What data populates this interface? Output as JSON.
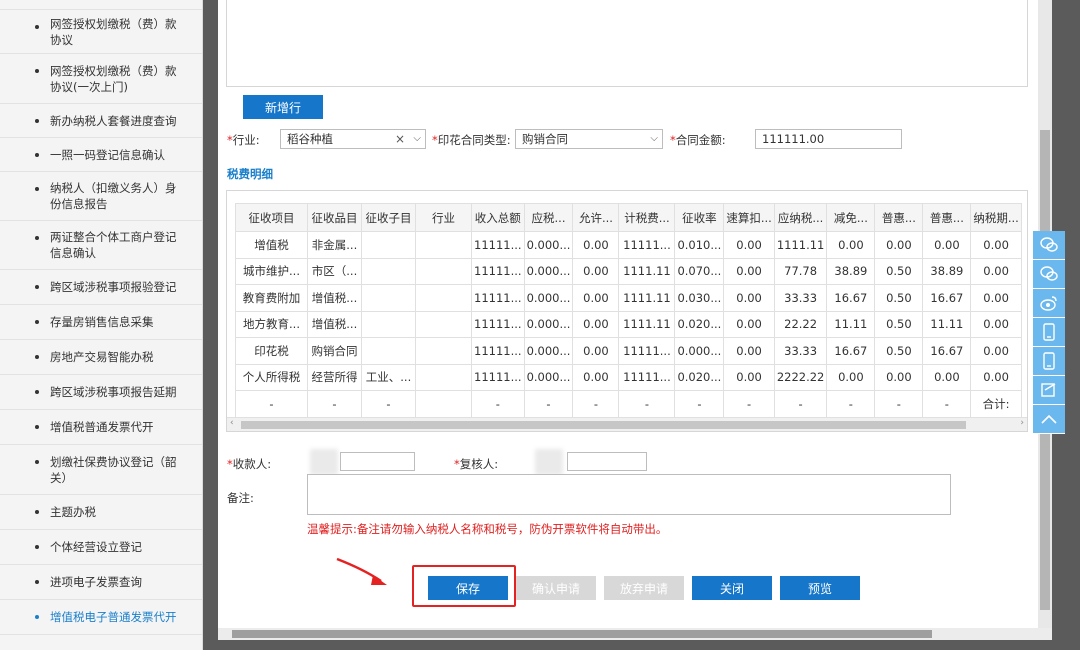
{
  "sidebar": {
    "items": [
      {
        "label": "网签授权划缴税（费）款协议"
      },
      {
        "label": "网签授权划缴税（费）款协议(一次上门)"
      },
      {
        "label": "新办纳税人套餐进度查询"
      },
      {
        "label": "一照一码登记信息确认"
      },
      {
        "label": "纳税人（扣缴义务人）身份信息报告"
      },
      {
        "label": "两证整合个体工商户登记信息确认"
      },
      {
        "label": "跨区域涉税事项报验登记"
      },
      {
        "label": "存量房销售信息采集"
      },
      {
        "label": "房地产交易智能办税"
      },
      {
        "label": "跨区域涉税事项报告延期"
      },
      {
        "label": "增值税普通发票代开"
      },
      {
        "label": "划缴社保费协议登记（韶关）"
      },
      {
        "label": "主题办税"
      },
      {
        "label": "个体经营设立登记"
      },
      {
        "label": "进项电子发票查询"
      },
      {
        "label": "增值税电子普通发票代开"
      }
    ]
  },
  "form": {
    "add_row_label": "新增行",
    "industry_label": "行业:",
    "industry_value": "稻谷种植",
    "contract_type_label": "印花合同类型:",
    "contract_type_value": "购销合同",
    "contract_amount_label": "合同金额:",
    "contract_amount_value": "111111.00",
    "section_title": "税费明细"
  },
  "table": {
    "headers": [
      "征收项目",
      "征收品目",
      "征收子目",
      "行业",
      "收入总额",
      "应税...",
      "允许...",
      "计税费...",
      "征收率",
      "速算扣...",
      "应纳税...",
      "减免...",
      "普惠...",
      "普惠...",
      "纳税期..."
    ],
    "rows": [
      [
        "增值税",
        "非金属...",
        "",
        "",
        "11111...",
        "0.000...",
        "0.00",
        "11111...",
        "0.010...",
        "0.00",
        "1111.11",
        "0.00",
        "0.00",
        "0.00",
        "0.00"
      ],
      [
        "城市维护...",
        "市区（...",
        "",
        "",
        "11111...",
        "0.000...",
        "0.00",
        "1111.11",
        "0.070...",
        "0.00",
        "77.78",
        "38.89",
        "0.50",
        "38.89",
        "0.00"
      ],
      [
        "教育费附加",
        "增值税...",
        "",
        "",
        "11111...",
        "0.000...",
        "0.00",
        "1111.11",
        "0.030...",
        "0.00",
        "33.33",
        "16.67",
        "0.50",
        "16.67",
        "0.00"
      ],
      [
        "地方教育...",
        "增值税...",
        "",
        "",
        "11111...",
        "0.000...",
        "0.00",
        "1111.11",
        "0.020...",
        "0.00",
        "22.22",
        "11.11",
        "0.50",
        "11.11",
        "0.00"
      ],
      [
        "印花税",
        "购销合同",
        "",
        "",
        "11111...",
        "0.000...",
        "0.00",
        "11111...",
        "0.000...",
        "0.00",
        "33.33",
        "16.67",
        "0.50",
        "16.67",
        "0.00"
      ],
      [
        "个人所得税",
        "经营所得",
        "工业、...",
        "",
        "11111...",
        "0.000...",
        "0.00",
        "11111...",
        "0.020...",
        "0.00",
        "2222.22",
        "0.00",
        "0.00",
        "0.00",
        "0.00"
      ],
      [
        "-",
        "-",
        "-",
        "",
        "-",
        "-",
        "-",
        "-",
        "-",
        "-",
        "-",
        "-",
        "-",
        "-",
        "合计:"
      ]
    ]
  },
  "bottom": {
    "payee_label": "收款人:",
    "reviewer_label": "复核人:",
    "note_label": "备注:",
    "hint": "温馨提示:备注请勿输入纳税人名称和税号，防伪开票软件将自动带出。",
    "buttons": {
      "save": "保存",
      "confirm": "确认申请",
      "abandon": "放弃申请",
      "close": "关闭",
      "preview": "预览"
    }
  },
  "colors": {
    "primary": "#1676c9",
    "highlight": "#e52222",
    "float_bar": "#6bb8ee"
  }
}
